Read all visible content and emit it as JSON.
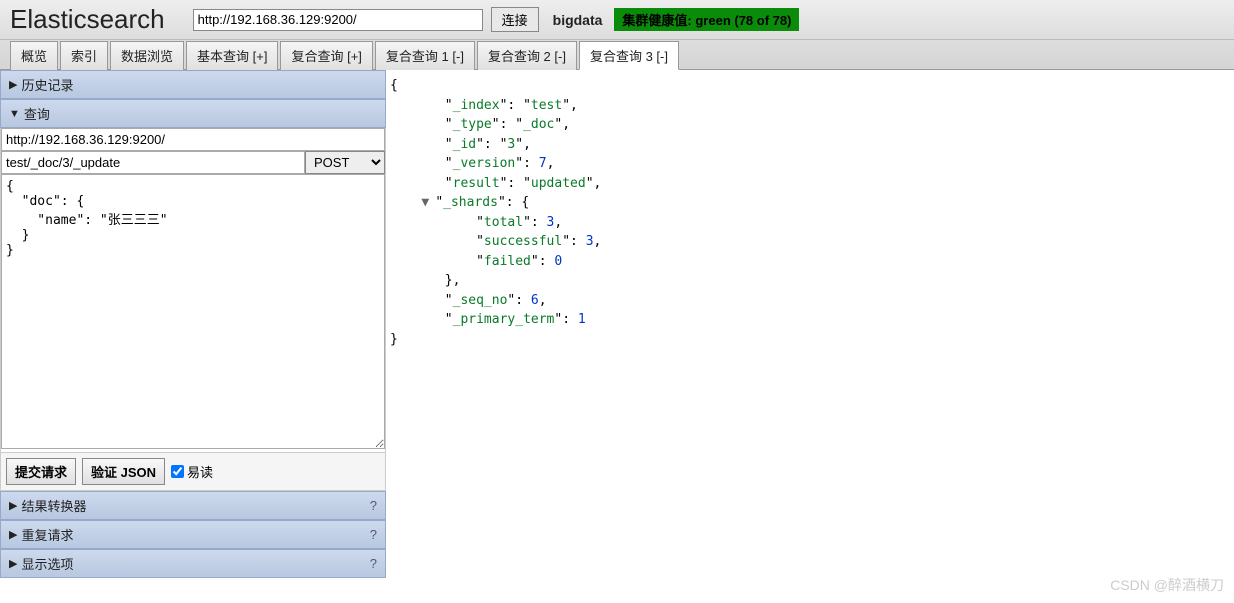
{
  "header": {
    "title": "Elasticsearch",
    "url": "http://192.168.36.129:9200/",
    "connect_label": "连接",
    "cluster_name": "bigdata",
    "health_text": "集群健康值: green (78 of 78)"
  },
  "tabs": [
    {
      "label": "概览",
      "active": false
    },
    {
      "label": "索引",
      "active": false
    },
    {
      "label": "数据浏览",
      "active": false
    },
    {
      "label": "基本查询 [+]",
      "active": false
    },
    {
      "label": "复合查询 [+]",
      "active": false
    },
    {
      "label": "复合查询 1 [-]",
      "active": false
    },
    {
      "label": "复合查询 2 [-]",
      "active": false
    },
    {
      "label": "复合查询 3 [-]",
      "active": true
    }
  ],
  "sections": {
    "history": {
      "label": "历史记录",
      "expanded": false
    },
    "query": {
      "label": "查询",
      "expanded": true
    },
    "transformer": {
      "label": "结果转换器",
      "expanded": false,
      "help": "?"
    },
    "repeat": {
      "label": "重复请求",
      "expanded": false,
      "help": "?"
    },
    "display": {
      "label": "显示选项",
      "expanded": false,
      "help": "?"
    }
  },
  "query": {
    "url": "http://192.168.36.129:9200/",
    "path": "test/_doc/3/_update",
    "method": "POST",
    "body": "{\n  \"doc\": {\n    \"name\": \"张三三三\"\n  }\n}"
  },
  "actions": {
    "submit": "提交请求",
    "validate": "验证 JSON",
    "pretty": "易读",
    "pretty_checked": true
  },
  "response": {
    "_index": "test",
    "_type": "_doc",
    "_id": "3",
    "_version": 7,
    "result": "updated",
    "_shards": {
      "total": 3,
      "successful": 3,
      "failed": 0
    },
    "_seq_no": 6,
    "_primary_term": 1
  },
  "watermark": "CSDN @醉酒横刀"
}
